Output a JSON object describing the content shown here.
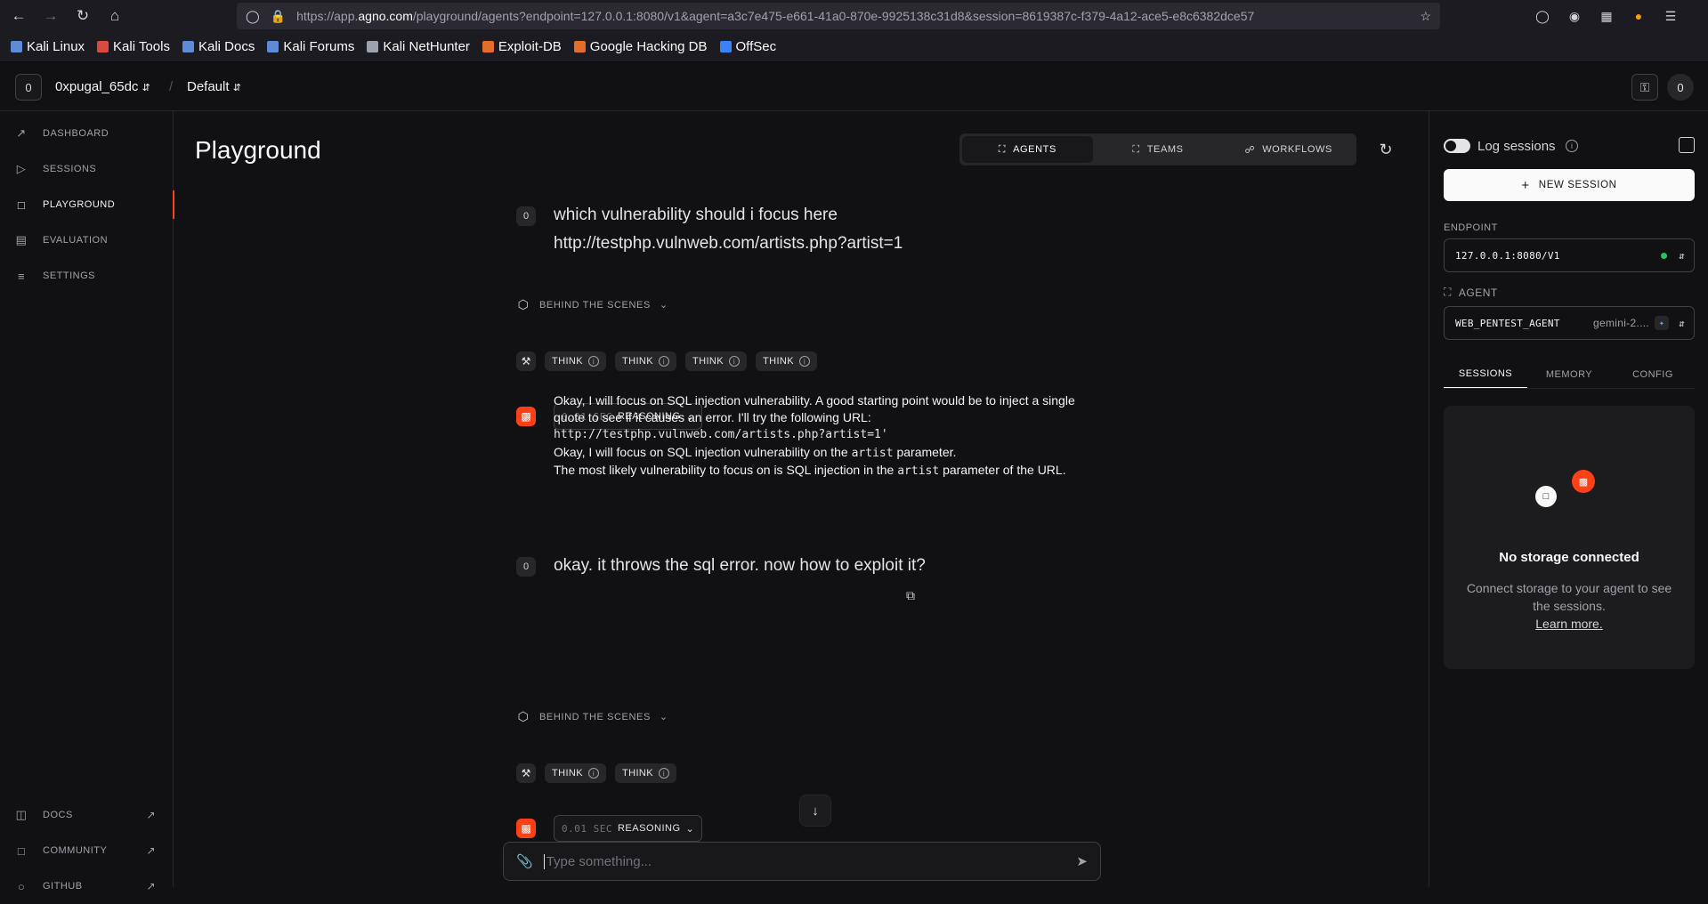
{
  "browser": {
    "url_prefix": "https://app.",
    "url_domain": "agno.com",
    "url_rest": "/playground/agents?endpoint=127.0.0.1:8080/v1&agent=a3c7e475-e661-41a0-870e-9925138c31d8&session=8619387c-f379-4a12-ace5-e8c6382dce57",
    "bookmarks": [
      {
        "label": "Kali Linux",
        "color": "#5e8bd6"
      },
      {
        "label": "Kali Tools",
        "color": "#d84b3e"
      },
      {
        "label": "Kali Docs",
        "color": "#5e8bd6"
      },
      {
        "label": "Kali Forums",
        "color": "#5e8bd6"
      },
      {
        "label": "Kali NetHunter",
        "color": "#9ca3af"
      },
      {
        "label": "Exploit-DB",
        "color": "#e46d2a"
      },
      {
        "label": "Google Hacking DB",
        "color": "#e46d2a"
      },
      {
        "label": "OffSec",
        "color": "#3b82f6"
      }
    ]
  },
  "header": {
    "workspace_badge": "0",
    "workspace_name": "0xpugal_65dc",
    "separator": "/",
    "project": "Default",
    "avatar": "0"
  },
  "sidebar": {
    "items": [
      {
        "label": "DASHBOARD"
      },
      {
        "label": "SESSIONS"
      },
      {
        "label": "PLAYGROUND"
      },
      {
        "label": "EVALUATION"
      },
      {
        "label": "SETTINGS"
      }
    ],
    "bottom": [
      {
        "label": "DOCS"
      },
      {
        "label": "COMMUNITY"
      },
      {
        "label": "GITHUB"
      }
    ]
  },
  "main": {
    "title": "Playground",
    "tabs": [
      {
        "label": "AGENTS"
      },
      {
        "label": "TEAMS"
      },
      {
        "label": "WORKFLOWS"
      }
    ],
    "messages": {
      "user1": {
        "badge": "0",
        "text": "which vulnerability should i focus here http://testphp.vulnweb.com/artists.php?artist=1"
      },
      "bts_label": "BEHIND THE SCENES",
      "tool_chip": "THINK",
      "reason_sec": "0.01 SEC",
      "reason_label": "REASONING",
      "answer": {
        "p1a": "Okay, I will focus on SQL injection vulnerability. A good starting point would be to inject a single quote to see if it causes an error. I'll try the following URL: ",
        "p1code": "http://testphp.vulnweb.com/artists.php?artist=1'",
        "p2a": "Okay, I will focus on SQL injection vulnerability on the ",
        "p2code": "artist",
        "p2b": " parameter.",
        "p3a": "The most likely vulnerability to focus on is SQL injection in the ",
        "p3code": "artist",
        "p3b": " parameter of the URL."
      },
      "user2": {
        "badge": "0",
        "text": "okay. it throws the sql error. now how to exploit it?"
      }
    },
    "composer_placeholder": "Type something..."
  },
  "rpanel": {
    "log_label": "Log sessions",
    "new_session": "NEW SESSION",
    "endpoint_label": "ENDPOINT",
    "endpoint_value": "127.0.0.1:8080/V1",
    "agent_label": "AGENT",
    "agent_value": "WEB_PENTEST_AGENT",
    "agent_model": "gemini-2....",
    "tabs": [
      {
        "label": "SESSIONS"
      },
      {
        "label": "MEMORY"
      },
      {
        "label": "CONFIG"
      }
    ],
    "storage_title": "No storage connected",
    "storage_desc": "Connect storage to your agent to see the sessions.",
    "storage_link": "Learn more."
  },
  "colors": {
    "accent": "#ff4017",
    "status_ok": "#22c55e"
  }
}
